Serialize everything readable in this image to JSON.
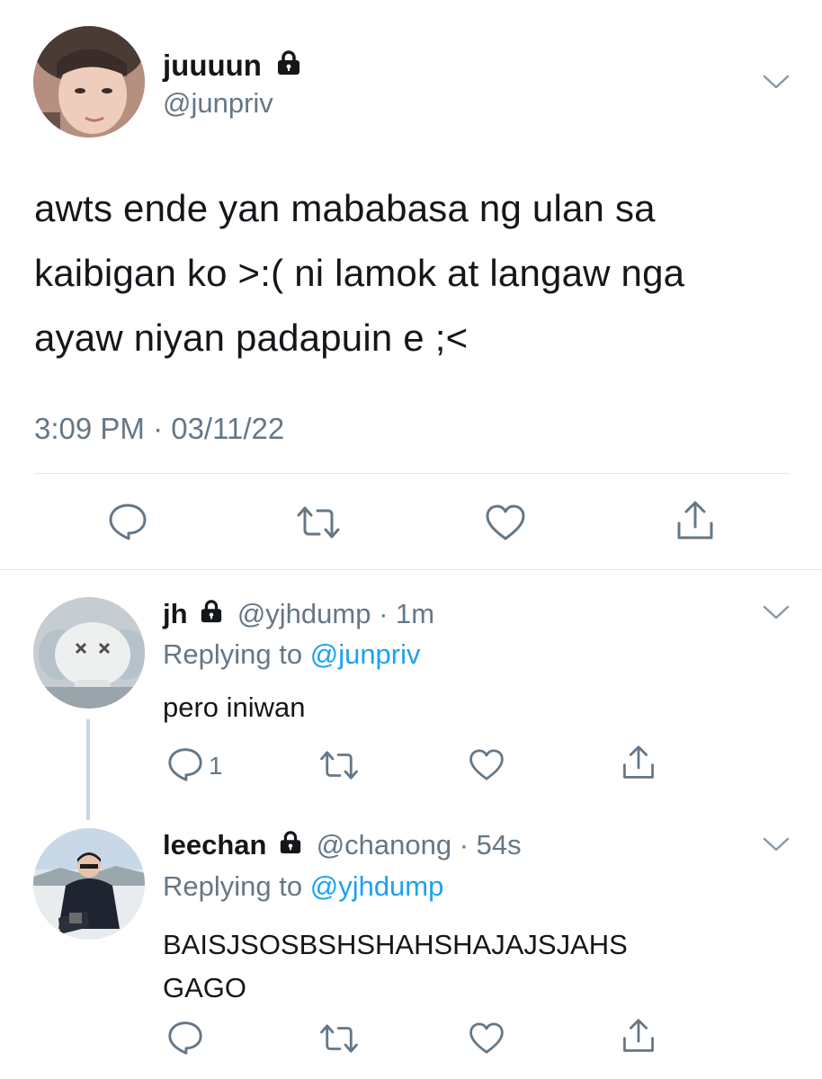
{
  "main_tweet": {
    "display_name": "juuuun",
    "handle": "@junpriv",
    "protected_icon": "lock-icon",
    "text_lines": [
      "awts ende yan mababasa ng ulan sa",
      "kaibigan ko >:( ni lamok at langaw nga",
      "ayaw niyan padapuin e ;<"
    ],
    "timestamp": "3:09 PM · 03/11/22",
    "actions": [
      "reply-icon",
      "retweet-icon",
      "like-icon",
      "share-icon"
    ]
  },
  "replies": [
    {
      "display_name": "jh",
      "handle": "@yjhdump",
      "time": "· 1m",
      "replying_prefix": "Replying to ",
      "replying_to": "@junpriv",
      "text_lines": [
        "pero iniwan"
      ],
      "reply_count": "1"
    },
    {
      "display_name": "leechan",
      "handle": "@chanong",
      "time": "· 54s",
      "replying_prefix": "Replying to ",
      "replying_to": "@yjhdump",
      "text_lines": [
        "BAISJSOSBSHSHAHSHAJAJSJAHS",
        "GAGO"
      ],
      "reply_count": ""
    }
  ],
  "colors": {
    "text": "#14171a",
    "muted": "#657786",
    "link": "#1da1f2",
    "divider": "#e1e8ed"
  }
}
